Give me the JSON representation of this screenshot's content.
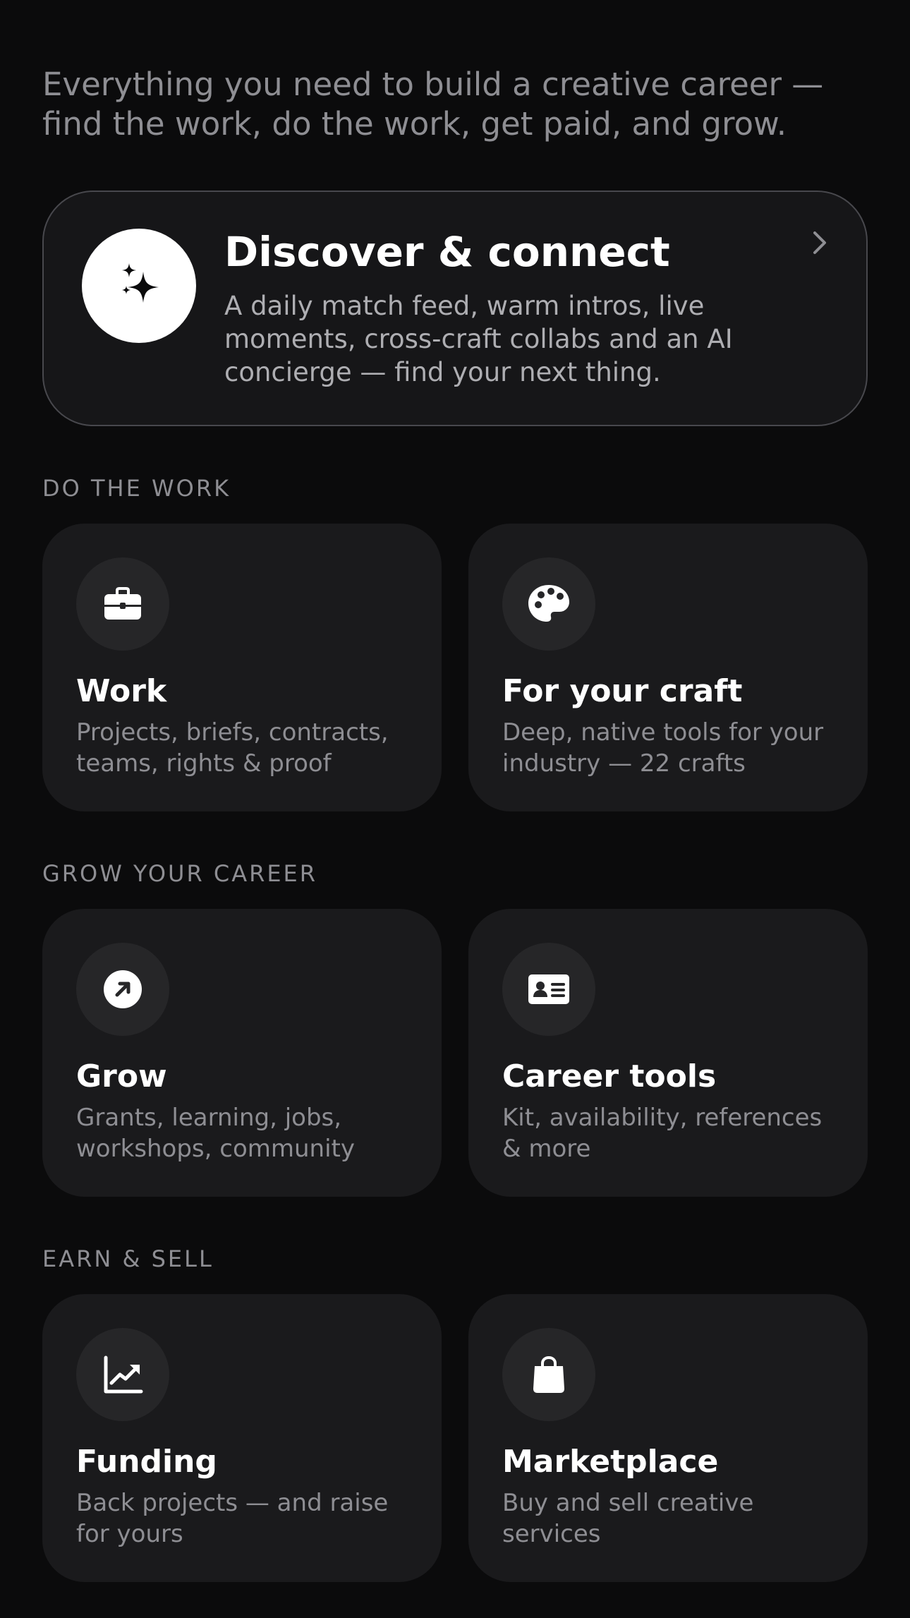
{
  "intro": "Everything you need to build a creative career — find the work, do the work, get paid, and grow.",
  "hero": {
    "title": "Discover & connect",
    "description": "A daily match feed, warm intros, live moments, cross-craft collabs and an AI concierge — find your next thing.",
    "icon": "sparkles-icon",
    "chevron_icon": "chevron-right-icon"
  },
  "sections": [
    {
      "label": "DO THE WORK",
      "cards": [
        {
          "title": "Work",
          "description": "Projects, briefs, contracts, teams, rights & proof",
          "icon": "briefcase-icon"
        },
        {
          "title": "For your craft",
          "description": "Deep, native tools for your industry — 22 crafts",
          "icon": "palette-icon"
        }
      ]
    },
    {
      "label": "GROW YOUR CAREER",
      "cards": [
        {
          "title": "Grow",
          "description": "Grants, learning, jobs, workshops, community",
          "icon": "arrow-up-right-circle-icon"
        },
        {
          "title": "Career tools",
          "description": "Kit, availability, references & more",
          "icon": "id-card-icon"
        }
      ]
    },
    {
      "label": "EARN & SELL",
      "cards": [
        {
          "title": "Funding",
          "description": "Back projects — and raise for yours",
          "icon": "chart-line-icon"
        },
        {
          "title": "Marketplace",
          "description": "Buy and sell creative services",
          "icon": "shopping-bag-icon"
        }
      ]
    }
  ],
  "colors": {
    "background": "#0b0b0c",
    "card": "#1a1a1c",
    "hero_card": "#161618",
    "hero_border": "#48484d",
    "icon_circle": "#262628",
    "text_primary": "#ffffff",
    "text_secondary": "#8e8e93"
  }
}
